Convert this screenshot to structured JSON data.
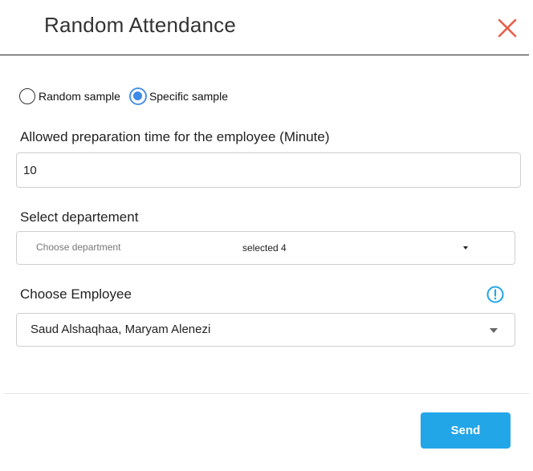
{
  "dialog": {
    "title": "Random Attendance",
    "close_icon": "close-icon"
  },
  "sample_type": {
    "options": [
      {
        "label": "Random sample",
        "checked": false
      },
      {
        "label": "Specific sample",
        "checked": true
      }
    ]
  },
  "prep_time": {
    "label": "Allowed preparation time for the employee (Minute)",
    "value": "10"
  },
  "department": {
    "label": "Select departement",
    "placeholder": "Choose department",
    "selected_text": "selected 4"
  },
  "employee": {
    "label": "Choose Employee",
    "value": "Saud Alshaqhaa, Maryam Alenezi",
    "info_icon": "info-icon"
  },
  "footer": {
    "send_label": "Send"
  },
  "colors": {
    "close": "#e8604c",
    "accent": "#22a6e8",
    "radio_checked": "#3d8be8"
  }
}
